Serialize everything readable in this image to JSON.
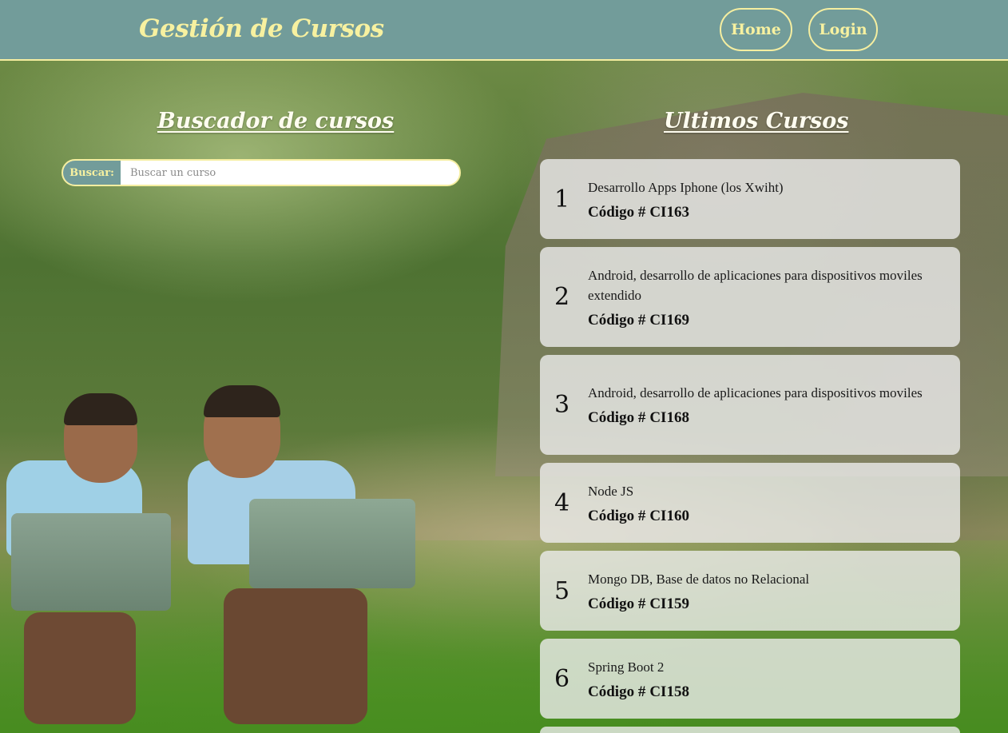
{
  "header": {
    "brand": "Gestión de Cursos",
    "nav": [
      {
        "label": "Home"
      },
      {
        "label": "Login"
      }
    ]
  },
  "search": {
    "title": "Buscador de cursos",
    "label": "Buscar:",
    "placeholder": "Buscar un curso",
    "value": ""
  },
  "latest": {
    "title": "Ultimos Cursos",
    "code_prefix": "Código #",
    "courses": [
      {
        "number": "1",
        "name": "Desarrollo Apps Iphone (los Xwiht)",
        "code": "CI163"
      },
      {
        "number": "2",
        "name": "Android, desarrollo de aplicaciones para dispositivos moviles extendido",
        "code": "CI169"
      },
      {
        "number": "3",
        "name": "Android, desarrollo de aplicaciones para dispositivos moviles",
        "code": "CI168"
      },
      {
        "number": "4",
        "name": "Node JS",
        "code": "CI160"
      },
      {
        "number": "5",
        "name": "Mongo DB, Base de datos no Relacional",
        "code": "CI159"
      },
      {
        "number": "6",
        "name": "Spring Boot 2",
        "code": "CI158"
      }
    ]
  },
  "colors": {
    "header_bg": "#729c9a",
    "accent_yellow": "#f7f1a0",
    "card_bg": "rgba(236,236,236,0.80)"
  }
}
